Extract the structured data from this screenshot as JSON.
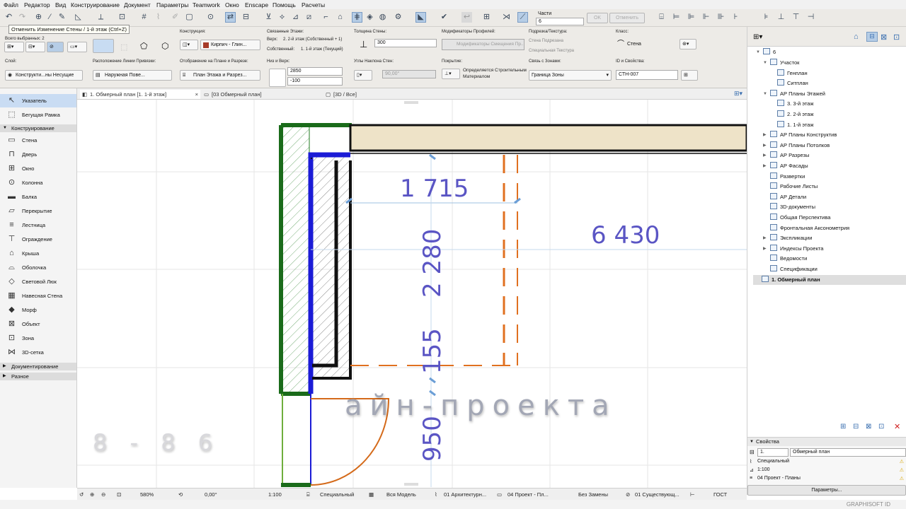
{
  "menu": [
    "Файл",
    "Редактор",
    "Вид",
    "Конструирование",
    "Документ",
    "Параметры",
    "Teamwork",
    "Окно",
    "Enscape",
    "Помощь",
    "Расчеты"
  ],
  "tooltip": "Отменить Изменение Стены / 1-й этаж (Ctrl+Z)",
  "toolbar_parts": {
    "label": "Части",
    "value": "6",
    "ok": "OK",
    "cancel": "Отменить"
  },
  "info": {
    "selected": "Всего выбранных: 2",
    "construction_label": "Конструкция:",
    "material": "Кирпич - Глин...",
    "linked_floors_label": "Связанные Этажи:",
    "top_label": "Верх:",
    "top_value": "2. 2-й этаж (Собственный + 1)",
    "own_label": "Собственный:",
    "own_value": "1. 1-й этаж (Текущий)",
    "thickness_label": "Толщина Стены:",
    "thickness": "300",
    "profile_mod_label": "Модификаторы Профилей:",
    "profile_mod_value": "Модификаторы Смещения Пр...",
    "surface_label": "Подрезка/Текстура:",
    "surface_1": "Стена Подрезана",
    "surface_2": "Специальная Текстура",
    "class_label": "Класс:",
    "class_value": "Стена",
    "layer_label": "Слой:",
    "layer_value": "Конструкти...ны Несущие",
    "refline_label": "Расположение Линии Привязки:",
    "refline_value": "Наружная Пове...",
    "display_label": "Отображение на Плане и Разрезе:",
    "display_value": "План Этажа и Разрез...",
    "height_label": "Низ и Верх:",
    "height_top": "2850",
    "height_bottom": "-100",
    "slant_label": "Углы Наклона Стен:",
    "slant_value": "90,00°",
    "cover_label": "Покрытие:",
    "cover_value": "Определяется Строительным Материалом",
    "zones_label": "Связь с Зонами:",
    "zones_value": "Граница Зоны",
    "id_label": "ID и Свойства:",
    "id_value": "СТН-007"
  },
  "toolbox": {
    "pointer": "Указатель",
    "marquee": "Бегущая Рамка",
    "section_design": "Конструирование",
    "tools": [
      "Стена",
      "Дверь",
      "Окно",
      "Колонна",
      "Балка",
      "Перекрытие",
      "Лестница",
      "Ограждение",
      "Крыша",
      "Оболочка",
      "Световой Люк",
      "Навесная Стена",
      "Морф",
      "Объект",
      "Зона",
      "3D-сетка"
    ],
    "section_doc": "Документирование",
    "section_misc": "Разное"
  },
  "tabs": [
    "1. Обмерный план [1. 1-й этаж]",
    "[03 Обмерный план]",
    "[3D / Все]"
  ],
  "drawing": {
    "dimensions": [
      "1 715",
      "6 430",
      "2 280",
      "155",
      "950"
    ],
    "watermark_1": "айн-проекта",
    "watermark_2": "8 - 8 6"
  },
  "navigator": {
    "root": "6",
    "items": [
      "Участок",
      "Генплан",
      "Ситплан",
      "АР Планы Этажей",
      "3. 3-й этаж",
      "2. 2-й этаж",
      "1. 1-й этаж",
      "АР Планы Конструктив",
      "АР Планы Потолков",
      "АР Разрезы",
      "АР Фасады",
      "Развертки",
      "Рабочие Листы",
      "АР Детали",
      "3D-документы",
      "Общая Перспектива",
      "Фронтальная Аксонометрия",
      "Экспликации",
      "Индексы Проекта",
      "Ведомости",
      "Спецификации",
      "1. Обмерный план"
    ]
  },
  "properties": {
    "title": "Свойства",
    "num": "1.",
    "name": "Обмерный план",
    "row1": "Специальный",
    "row2": "1:100",
    "row3": "04 Проект - Планы",
    "button": "Параметры..."
  },
  "status": {
    "zoom": "580%",
    "angle": "0,00°",
    "scale": "1:100",
    "pen_set": "Специальный",
    "model": "Вся Модель",
    "layer_combo": "01 Архитектурн...",
    "view": "04 Проект - Пл...",
    "override": "Без Замены",
    "reno": "01 Существующ...",
    "standard": "ГОСТ"
  },
  "brand": "GRAPHISOFT ID"
}
